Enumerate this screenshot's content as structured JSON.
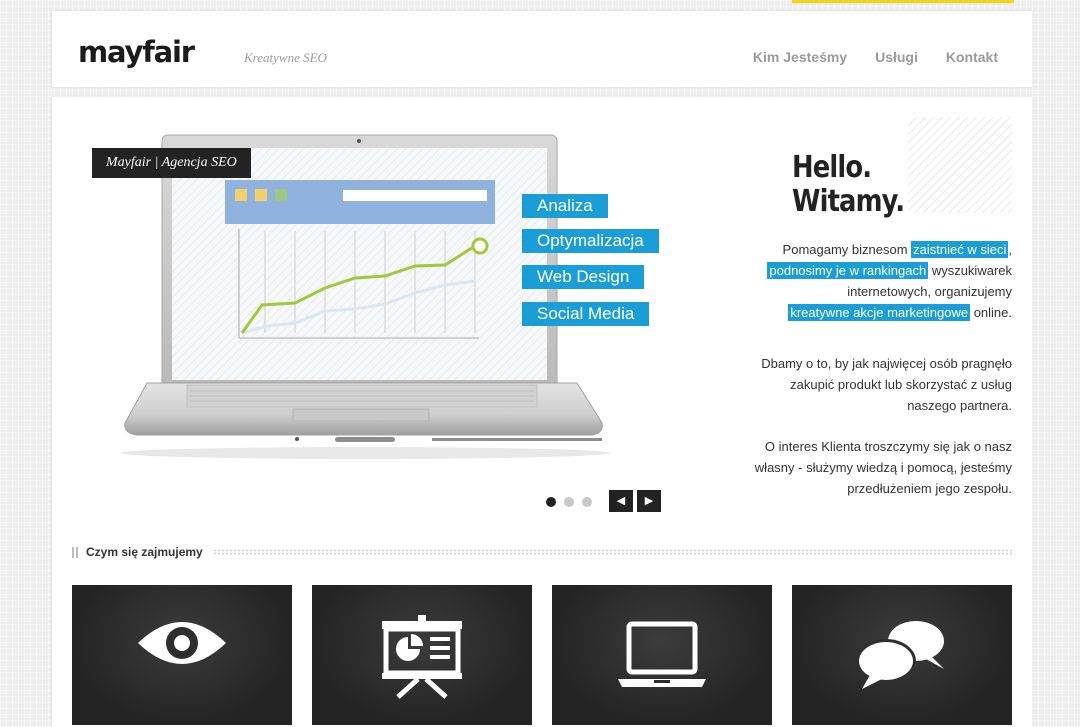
{
  "header": {
    "logo": "mayfair",
    "tagline": "Kreatywne SEO",
    "nav": [
      "Kim Jesteśmy",
      "Usługi",
      "Kontakt"
    ]
  },
  "slider": {
    "badge": "Mayfair | Agencja SEO",
    "pills": [
      "Analiza",
      "Optymalizacja",
      "Web Design",
      "Social Media"
    ],
    "active_dot": 1,
    "dots": 3
  },
  "intro": {
    "hello": "Hello.",
    "witamy": "Witamy.",
    "p1": {
      "t1": "Pomagamy biznesom ",
      "h1": "zaistnieć w sieci",
      "t2": ",",
      "h2": "podnosimy je w rankingach",
      "t3": " wyszukiwarek internetowych, organizujemy ",
      "h3": "kreatywne akcje marketingowe",
      "t4": " online."
    },
    "p2": "Dbamy o to, by jak najwięcej osób pragnęło zakupić produkt lub skorzystać z usług naszego partnera.",
    "p3": "O interes Klienta troszczymy się jak o nasz własny - służymy wiedzą i pomocą, jesteśmy przedłużeniem jego zespołu."
  },
  "services": {
    "title": "Czym się zajmujemy",
    "icons": [
      "eye-icon",
      "presentation-board-icon",
      "laptop-icon",
      "chat-bubbles-icon"
    ]
  },
  "colors": {
    "accent_blue": "#1b9ed8",
    "accent_yellow": "#f5d312",
    "dark": "#222222"
  }
}
